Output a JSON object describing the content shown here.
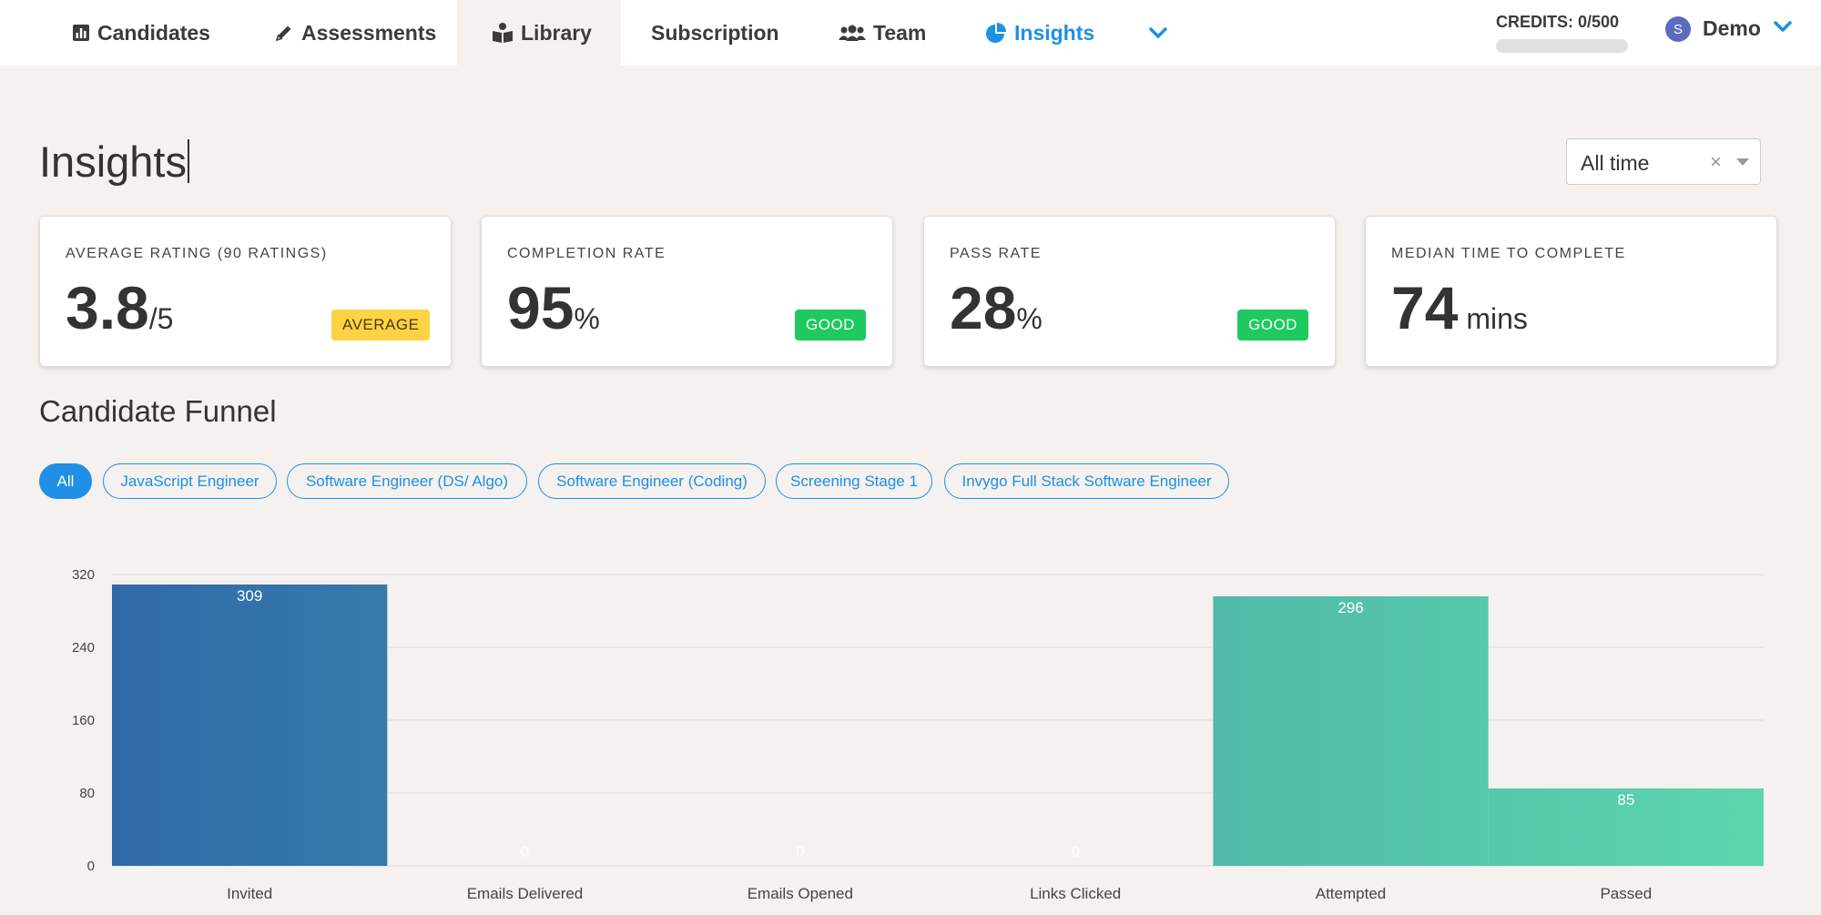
{
  "nav": {
    "items": [
      {
        "label": "Candidates",
        "icon": "bar-chart-icon"
      },
      {
        "label": "Assessments",
        "icon": "pencil-icon"
      },
      {
        "label": "Library",
        "icon": "book-reader-icon"
      },
      {
        "label": "Subscription",
        "icon": ""
      },
      {
        "label": "Team",
        "icon": "users-icon"
      },
      {
        "label": "Insights",
        "icon": "pie-chart-icon"
      }
    ],
    "more_icon": "chevron-down-icon",
    "accent": "#1e90e6",
    "credits": {
      "label": "CREDITS: 0/500",
      "used": 0,
      "total": 500
    },
    "user": {
      "initial": "S",
      "name": "Demo"
    }
  },
  "page": {
    "title": "Insights",
    "range": {
      "value": "All time",
      "clear": "×"
    }
  },
  "stats": [
    {
      "label": "AVERAGE RATING (90 RATINGS)",
      "value": "3.8",
      "unit": "/5",
      "badge": "AVERAGE",
      "badge_color": "#fcd344"
    },
    {
      "label": "COMPLETION RATE",
      "value": "95",
      "unit": "%",
      "badge": "GOOD",
      "badge_color": "#1ec95f"
    },
    {
      "label": "PASS RATE",
      "value": "28",
      "unit": "%",
      "badge": "GOOD",
      "badge_color": "#1ec95f"
    },
    {
      "label": "MEDIAN TIME TO COMPLETE",
      "value": "74",
      "unit": " mins",
      "badge": ""
    }
  ],
  "funnel": {
    "title": "Candidate Funnel",
    "filters": [
      {
        "label": "All",
        "active": true
      },
      {
        "label": "JavaScript Engineer"
      },
      {
        "label": "Software Engineer (DS/ Algo)"
      },
      {
        "label": "Software Engineer (Coding)"
      },
      {
        "label": "Screening Stage 1"
      },
      {
        "label": "Invygo Full Stack Software Engineer"
      }
    ]
  },
  "chart_data": {
    "type": "bar",
    "categories": [
      "Invited",
      "Emails Delivered",
      "Emails Opened",
      "Links Clicked",
      "Attempted",
      "Passed"
    ],
    "values": [
      309,
      0,
      0,
      0,
      296,
      85
    ],
    "yticks": [
      0,
      80,
      160,
      240,
      320
    ],
    "ylim": [
      0,
      320
    ],
    "grid": true,
    "title": "",
    "xlabel": "",
    "ylabel": "",
    "colors": [
      "#2f6aa8",
      "#4fbaa8",
      "#5bd4ac"
    ]
  }
}
